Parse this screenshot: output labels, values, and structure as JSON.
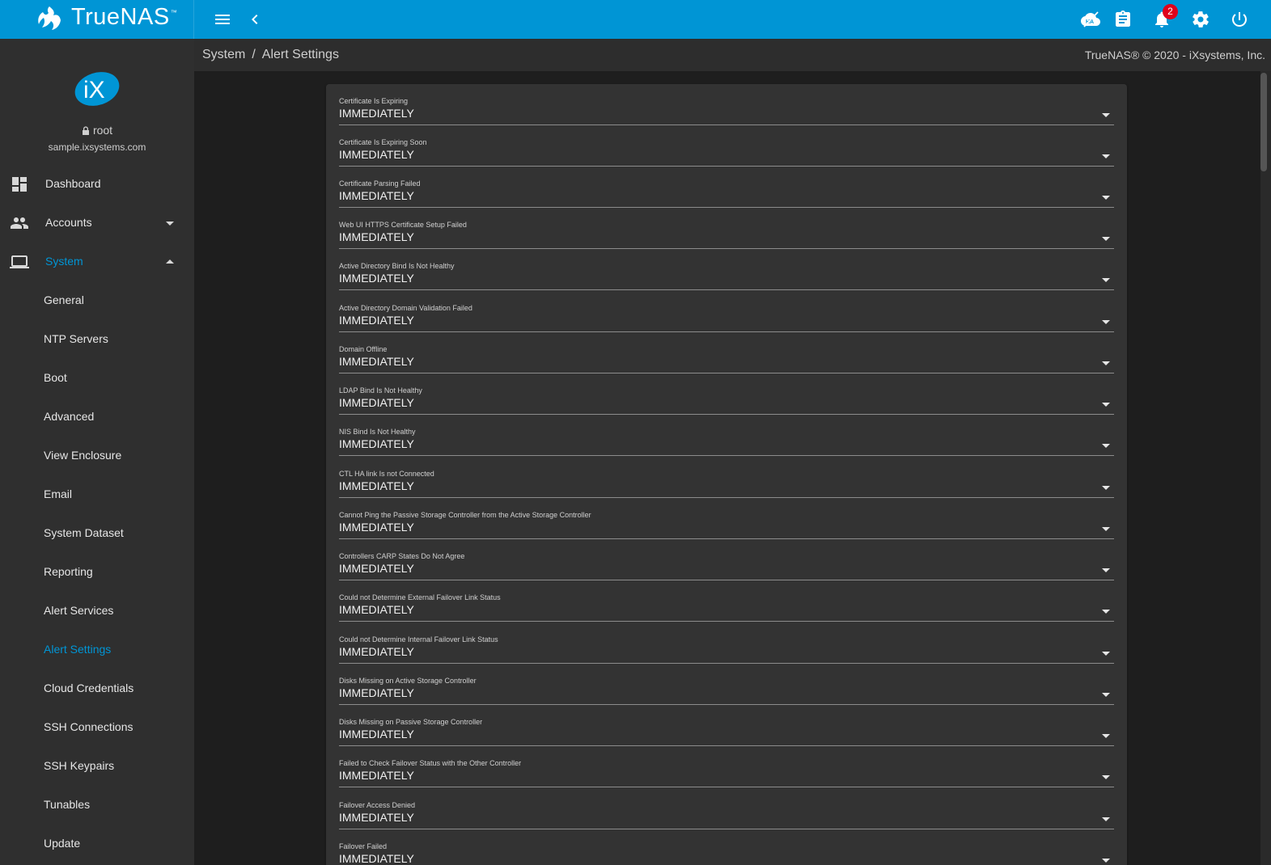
{
  "app": {
    "brand": "TrueNAS",
    "trademark": "™"
  },
  "topbar": {
    "menu_icon": "hamburger-icon",
    "back_icon": "chevron-left-icon",
    "ha_icon": "ha-disabled-icon",
    "tasks_icon": "clipboard-icon",
    "alerts_icon": "bell-icon",
    "alerts_count": "2",
    "settings_icon": "gear-icon",
    "power_icon": "power-icon"
  },
  "user": {
    "name": "root",
    "host": "sample.ixsystems.com"
  },
  "nav": [
    {
      "label": "Dashboard",
      "icon": "dashboard-icon"
    },
    {
      "label": "Accounts",
      "icon": "people-icon"
    },
    {
      "label": "System",
      "icon": "laptop-icon"
    }
  ],
  "system_sub": [
    {
      "label": "General"
    },
    {
      "label": "NTP Servers"
    },
    {
      "label": "Boot"
    },
    {
      "label": "Advanced"
    },
    {
      "label": "View Enclosure"
    },
    {
      "label": "Email"
    },
    {
      "label": "System Dataset"
    },
    {
      "label": "Reporting"
    },
    {
      "label": "Alert Services"
    },
    {
      "label": "Alert Settings"
    },
    {
      "label": "Cloud Credentials"
    },
    {
      "label": "SSH Connections"
    },
    {
      "label": "SSH Keypairs"
    },
    {
      "label": "Tunables"
    },
    {
      "label": "Update"
    }
  ],
  "breadcrumb": {
    "parent": "System",
    "separator": "/",
    "current": "Alert Settings"
  },
  "copyright": "TrueNAS® © 2020 - iXsystems, Inc.",
  "colors": {
    "accent": "#0095d5",
    "badge": "#e0001b",
    "sidebar": "#2f2f2f",
    "card": "#333333"
  },
  "alert_settings": [
    {
      "label": "Certificate Is Expiring",
      "value": "IMMEDIATELY"
    },
    {
      "label": "Certificate Is Expiring Soon",
      "value": "IMMEDIATELY"
    },
    {
      "label": "Certificate Parsing Failed",
      "value": "IMMEDIATELY"
    },
    {
      "label": "Web UI HTTPS Certificate Setup Failed",
      "value": "IMMEDIATELY"
    },
    {
      "label": "Active Directory Bind Is Not Healthy",
      "value": "IMMEDIATELY"
    },
    {
      "label": "Active Directory Domain Validation Failed",
      "value": "IMMEDIATELY"
    },
    {
      "label": "Domain Offline",
      "value": "IMMEDIATELY"
    },
    {
      "label": "LDAP Bind Is Not Healthy",
      "value": "IMMEDIATELY"
    },
    {
      "label": "NIS Bind Is Not Healthy",
      "value": "IMMEDIATELY"
    },
    {
      "label": "CTL HA link Is not Connected",
      "value": "IMMEDIATELY"
    },
    {
      "label": "Cannot Ping the Passive Storage Controller from the Active Storage Controller",
      "value": "IMMEDIATELY"
    },
    {
      "label": "Controllers CARP States Do Not Agree",
      "value": "IMMEDIATELY"
    },
    {
      "label": "Could not Determine External Failover Link Status",
      "value": "IMMEDIATELY"
    },
    {
      "label": "Could not Determine Internal Failover Link Status",
      "value": "IMMEDIATELY"
    },
    {
      "label": "Disks Missing on Active Storage Controller",
      "value": "IMMEDIATELY"
    },
    {
      "label": "Disks Missing on Passive Storage Controller",
      "value": "IMMEDIATELY"
    },
    {
      "label": "Failed to Check Failover Status with the Other Controller",
      "value": "IMMEDIATELY"
    },
    {
      "label": "Failover Access Denied",
      "value": "IMMEDIATELY"
    },
    {
      "label": "Failover Failed",
      "value": "IMMEDIATELY"
    }
  ]
}
